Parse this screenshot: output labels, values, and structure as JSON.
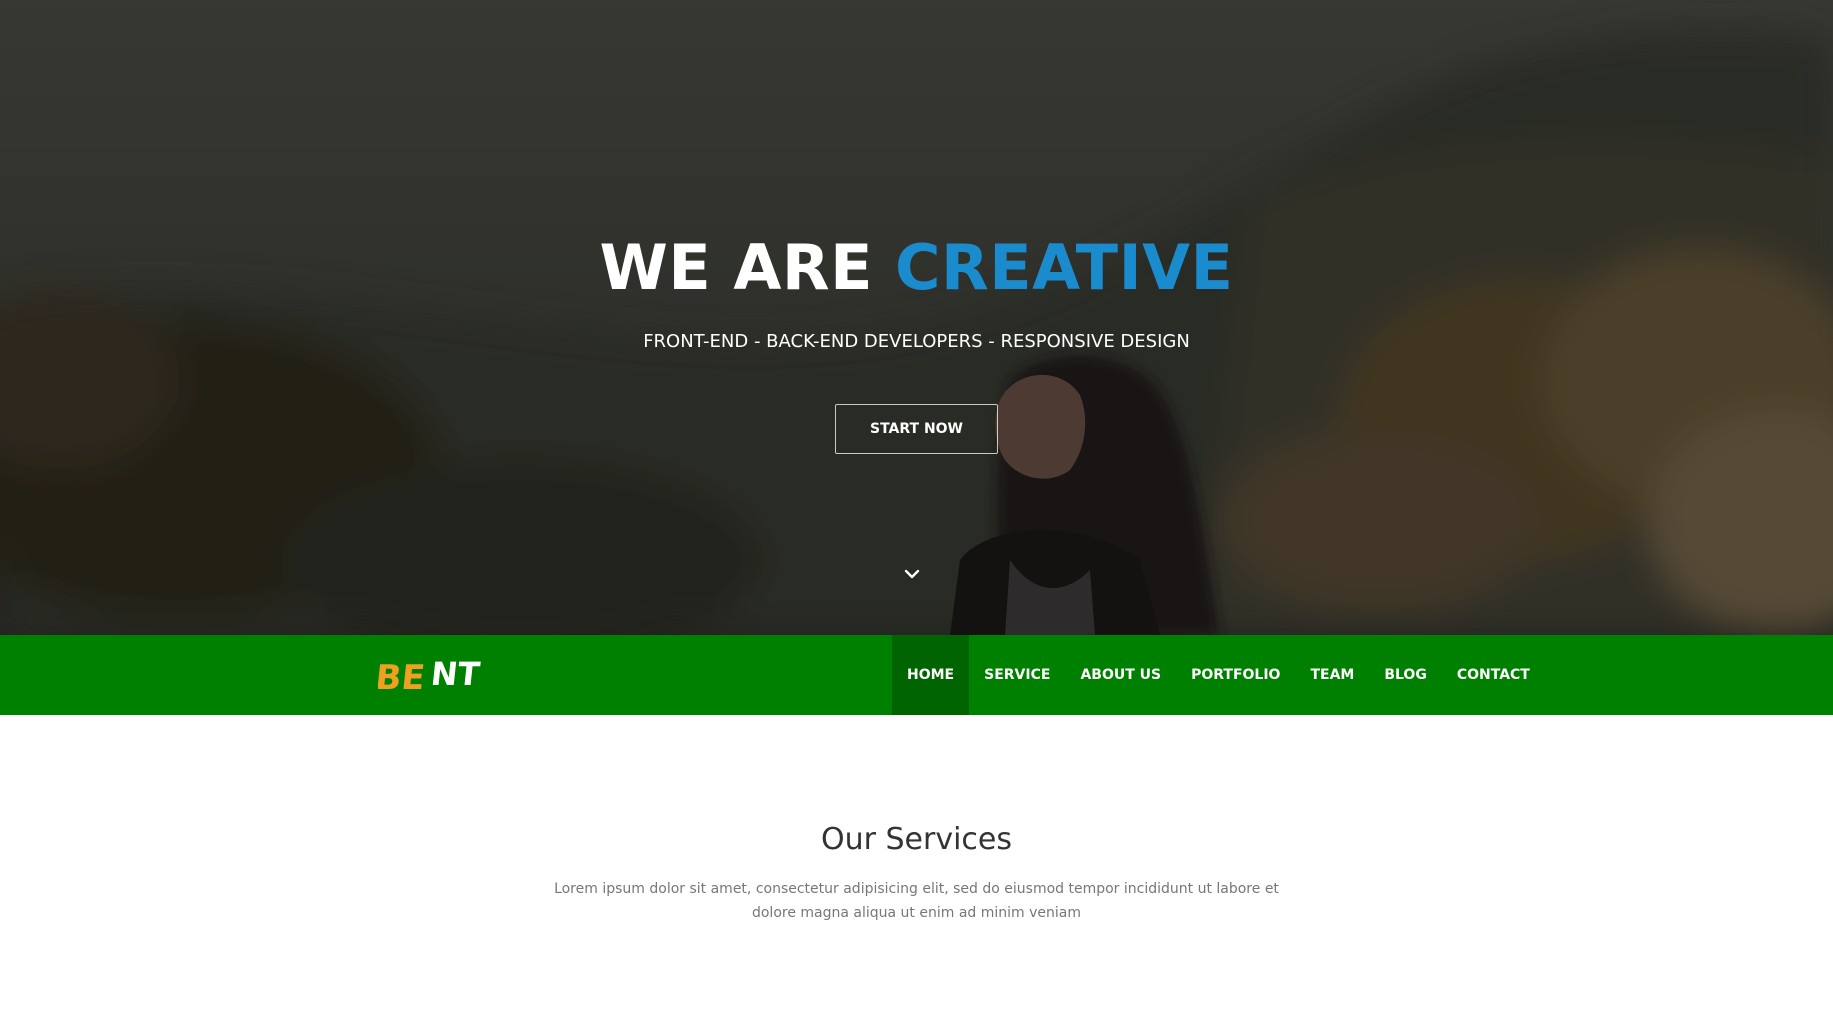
{
  "hero": {
    "title_main": "WE ARE ",
    "title_accent": "CREATIVE",
    "subtitle": "FRONT-END - BACK-END DEVELOPERS - RESPONSIVE DESIGN",
    "button_label": "START NOW",
    "scroll_icon": "chevron-down-icon"
  },
  "navbar": {
    "logo_text": "BENT",
    "items": [
      {
        "label": "HOME",
        "active": true
      },
      {
        "label": "SERVICE",
        "active": false
      },
      {
        "label": "ABOUT US",
        "active": false
      },
      {
        "label": "PORTFOLIO",
        "active": false
      },
      {
        "label": "TEAM",
        "active": false
      },
      {
        "label": "BLOG",
        "active": false
      },
      {
        "label": "CONTACT",
        "active": false
      }
    ]
  },
  "services": {
    "title": "Our Services",
    "description": "Lorem ipsum dolor sit amet, consectetur adipisicing elit, sed do eiusmod tempor incididunt ut labore et dolore magna aliqua ut enim ad minim veniam"
  },
  "colors": {
    "accent_blue": "#1a8ccd",
    "nav_green": "#008000",
    "nav_active": "#006400",
    "logo_orange": "#f0a020"
  }
}
